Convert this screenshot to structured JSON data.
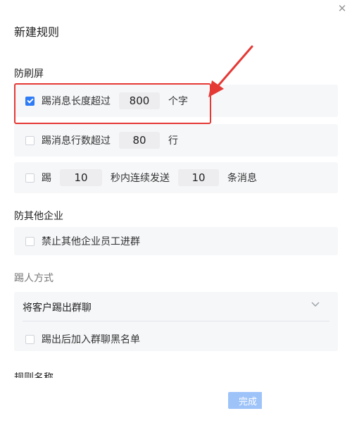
{
  "dialog": {
    "title": "新建规则",
    "close_icon": "close-icon"
  },
  "anti_spam": {
    "heading": "防刷屏",
    "length_rule": {
      "checked": true,
      "prefix": "踢消息长度超过",
      "value": "800",
      "suffix": "个字"
    },
    "lines_rule": {
      "checked": false,
      "prefix": "踢消息行数超过",
      "value": "80",
      "suffix": "行"
    },
    "burst_rule": {
      "checked": false,
      "prefix": "踢",
      "seconds": "10",
      "middle": "秒内连续发送",
      "count": "10",
      "suffix": "条消息"
    }
  },
  "anti_other_company": {
    "heading": "防其他企业",
    "block_rule": {
      "checked": false,
      "label": "禁止其他企业员工进群"
    }
  },
  "kick_method": {
    "heading": "踢人方式",
    "selected": "将客户踢出群聊",
    "blacklist": {
      "checked": false,
      "label": "踢出后加入群聊黑名单"
    }
  },
  "rule_name": {
    "heading": "规则名称"
  },
  "footer": {
    "done_label": "完成"
  },
  "colors": {
    "accent": "#2f7cf6",
    "annotation": "#e53935",
    "disabled_button": "#9ec3f9"
  }
}
